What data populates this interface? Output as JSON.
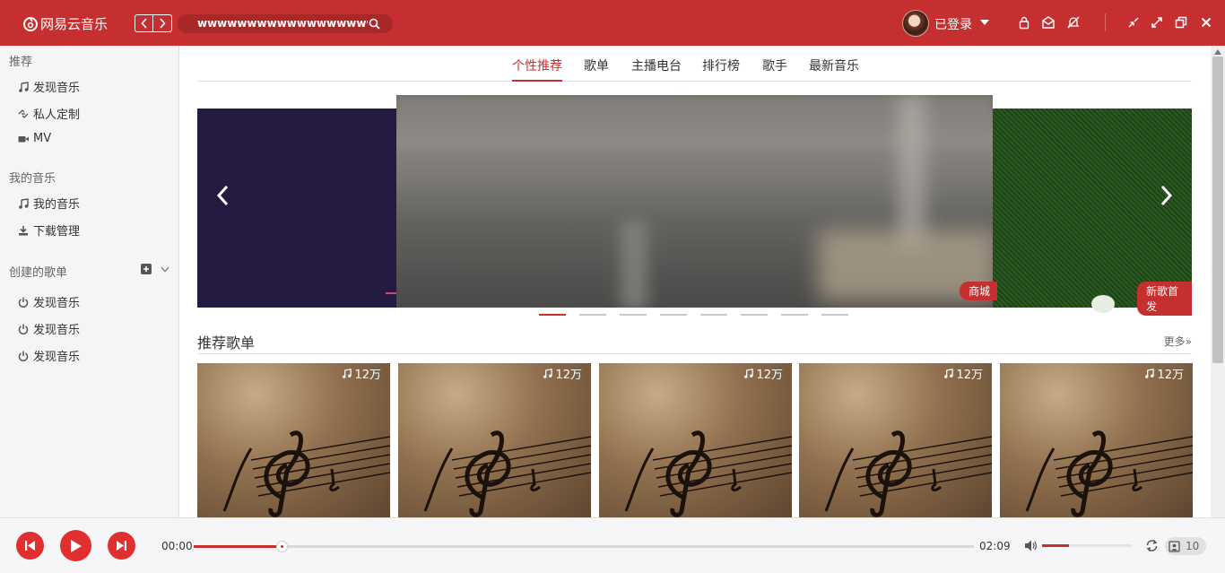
{
  "app": {
    "logo_text": "网易云音乐",
    "search_value": "wwwwwwwwwwwwwwwwwwwwwwwwwwwww",
    "user_status": "已登录"
  },
  "sidebar": {
    "sections": [
      {
        "title": "推荐",
        "items": [
          {
            "label": "发现音乐",
            "icon": "music-note-icon"
          },
          {
            "label": "私人定制",
            "icon": "custom-icon"
          },
          {
            "label": "MV",
            "icon": "video-camera-icon"
          }
        ]
      },
      {
        "title": "我的音乐",
        "items": [
          {
            "label": "我的音乐",
            "icon": "music-note-icon"
          },
          {
            "label": "下载管理",
            "icon": "download-icon"
          }
        ]
      },
      {
        "title": "创建的歌单",
        "items": [
          {
            "label": "发现音乐",
            "icon": "power-icon"
          },
          {
            "label": "发现音乐",
            "icon": "power-icon"
          },
          {
            "label": "发现音乐",
            "icon": "power-icon"
          }
        ]
      }
    ]
  },
  "tabs": [
    {
      "label": "个性推荐",
      "active": true
    },
    {
      "label": "歌单",
      "active": false
    },
    {
      "label": "主播电台",
      "active": false
    },
    {
      "label": "排行榜",
      "active": false
    },
    {
      "label": "歌手",
      "active": false
    },
    {
      "label": "最新音乐",
      "active": false
    }
  ],
  "banner": {
    "center_tag": "商城",
    "right_tag": "新歌首发",
    "dot_count": 8,
    "active_dot": 0
  },
  "playlist_section": {
    "title": "推荐歌单",
    "more": "更多»",
    "cards": [
      {
        "play_count": "12万"
      },
      {
        "play_count": "12万"
      },
      {
        "play_count": "12万"
      },
      {
        "play_count": "12万"
      },
      {
        "play_count": "12万"
      }
    ]
  },
  "player": {
    "current_time": "00:00",
    "total_time": "02:09",
    "progress": 0.113,
    "volume": 0.3,
    "playlist_count": "10"
  },
  "colors": {
    "accent": "#c62f2f",
    "player_button": "#e02f2f"
  }
}
